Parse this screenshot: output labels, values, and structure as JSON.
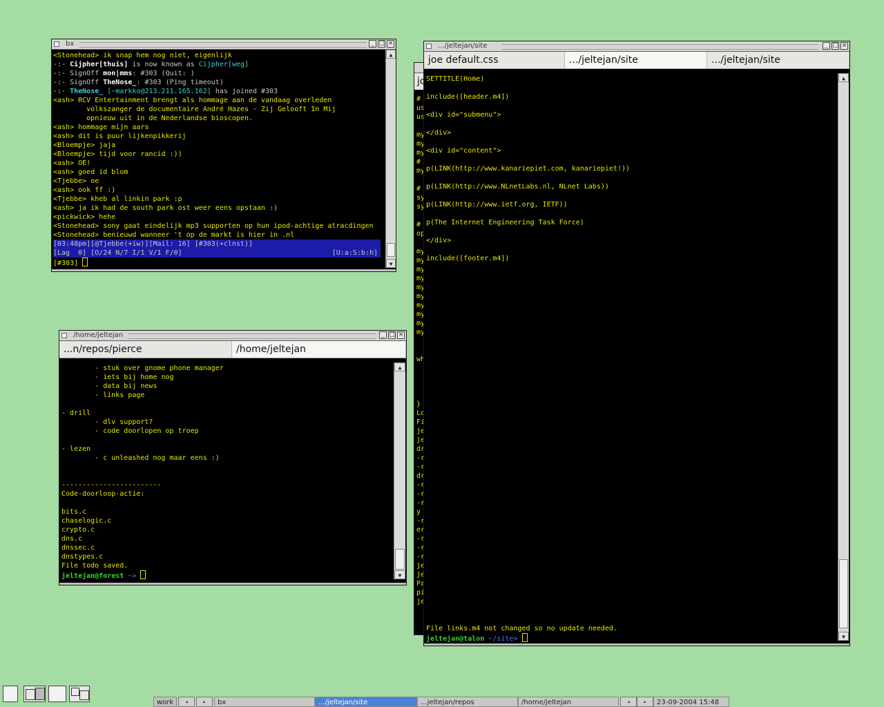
{
  "irc": {
    "title": "bx",
    "status1": "[03:48pm][@Tjebbe(+iw)][Mail: 16] [#303(+clnst)]",
    "status2_left": "[Lag  0] [O/24 N/7 I/1 V/1 F/0]",
    "status2_right": "[U:a:S:b:h]",
    "prompt": "[#303] ",
    "lines": [
      {
        "nick": "<Stonehead>",
        "text": " ik snap hem nog niet, eigenlijk"
      },
      {
        "pre": "-:- ",
        "b": "Cijpher[thuis]",
        "text": " is now known as ",
        "c": "Cijpher[weg]"
      },
      {
        "pre": "-:- SignOff ",
        "b": "mon|mms",
        "text": ": #303 (Quit: )"
      },
      {
        "pre": "-:- SignOff ",
        "b": "TheNose_",
        "text": ": #303 (Ping timeout)"
      },
      {
        "pre": "-:- ",
        "bc": "TheNose_",
        "c": " [~markko@213.211.165.162]",
        "text": " has joined #303"
      },
      {
        "nick": "<ash>",
        "text": " RCV Entertainment brengt als hommage aan de vandaag overleden"
      },
      {
        "text": "        volkszanger de documentaire André Hazes - Zij Gelooft In Mij"
      },
      {
        "text": "        opnieuw uit in de Nederlandse bioscopen."
      },
      {
        "nick": "<ash>",
        "text": " hommage mijn aars"
      },
      {
        "nick": "<ash>",
        "text": " dit is puur lijkenpikkerij"
      },
      {
        "nick": "<Bloempje>",
        "text": " jaja"
      },
      {
        "nick": "<Bloempje>",
        "text": " tijd voor rancid :))"
      },
      {
        "nick": "<ash>",
        "text": " OE!"
      },
      {
        "nick": "<ash>",
        "text": " goed id blom"
      },
      {
        "nick": "<Tjebbe>",
        "text": " oe"
      },
      {
        "nick": "<ash>",
        "text": " ook ff :)"
      },
      {
        "nick": "<Tjebbe>",
        "text": " kheb al linkin park :p"
      },
      {
        "nick": "<ash>",
        "text": " ja ik had de south park ost weer eens opstaan :)"
      },
      {
        "nick": "<pickwick>",
        "text": " hehe"
      },
      {
        "nick": "<Stonehead>",
        "text": " sony gaat eindelijk mp3 supporten op hun ipod-achtige atracdingen"
      },
      {
        "nick": "<Stonehead>",
        "text": " benieuwd wanneer 't op de markt is hier in .nl"
      }
    ]
  },
  "home": {
    "title": "/home/jeltejan",
    "tabs": [
      "...n/repos/pierce",
      "/home/jeltejan"
    ],
    "lines": [
      "        - stuk over gnome phone manager",
      "        - iets bij home nog",
      "        - data bij news",
      "        - links page",
      "",
      "- drill",
      "        - dlv support?",
      "        - code doorlopen op troep",
      "",
      "- lezen",
      "        - c unleashed nog maar eens :)",
      "",
      "",
      "------------------------",
      "Code-doorloop-actie:",
      "",
      "bits.c",
      "chaselogic.c",
      "crypto.c",
      "dns.c",
      "dnssec.c",
      "dnstypes.c",
      "File todo saved."
    ],
    "prompt_user": "jeltejan@forest",
    "prompt_path": " ~>"
  },
  "site": {
    "title": ".../jeltejan/site",
    "tabs": [
      "joe default.css",
      ".../jeltejan/site",
      ".../jeltejan/site"
    ],
    "lines": [
      "SETTITLE(Home)",
      "",
      "include([header.m4])",
      "",
      "<div id=\"submenu\">",
      "",
      "</div>",
      "",
      "<div id=\"content\">",
      "",
      "p(LINK(http://www.kanariepiet.com, kanariepiet!))",
      "",
      "p(LINK(http://www.NLnetLabs.nl, NLnet Labs))",
      "",
      "p(LINK(http://www.ietf.org, IETF))",
      "",
      "p(The Internet Engineering Task Force)",
      "",
      "</div>",
      "",
      "include([footer.m4])"
    ],
    "status_line": "File links.m4 not changed so no update needed.",
    "prompt_user": "jeltejan@talon",
    "prompt_path": " ~/site>"
  },
  "back": {
    "tab_label": "jo",
    "gutter": [
      "#",
      "us",
      "us",
      "",
      "my",
      "my",
      "my",
      "#",
      "my",
      "",
      "#",
      "sy",
      "sy",
      "",
      "#",
      "op",
      "",
      "my",
      "my",
      "my",
      "my",
      "my",
      "my",
      "my",
      "my",
      "my",
      "my",
      "",
      "",
      "wh",
      "",
      "",
      "",
      "",
      "}",
      "Lo",
      "Fi",
      "je",
      "je",
      "dr",
      "-r",
      "-r",
      "dr",
      "-r",
      "-r",
      "-r",
      "y",
      "-r",
      "er",
      "-r",
      "-r",
      "-r",
      "je",
      "je",
      "Pa",
      "pi",
      "je"
    ]
  },
  "taskbar": {
    "workspace": "work",
    "items": [
      "bx",
      ".../jeltejan/site",
      "...jeltejan/repos",
      "/home/jeltejan"
    ],
    "clock": "23-09-2004 15:48",
    "prev": "◂",
    "next": "▸"
  }
}
